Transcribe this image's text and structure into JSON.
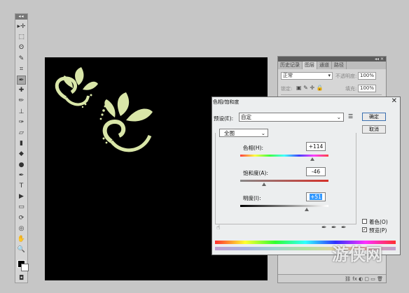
{
  "toolbar": {
    "tools": [
      "move-tool",
      "marquee-tool",
      "lasso-tool",
      "quick-select-tool",
      "crop-tool",
      "eyedropper-tool",
      "spot-heal-tool",
      "brush-tool",
      "stamp-tool",
      "history-brush-tool",
      "eraser-tool",
      "gradient-tool",
      "blur-tool",
      "dodge-tool",
      "pen-tool",
      "type-tool",
      "path-select-tool",
      "shape-tool",
      "3d-rotate-tool",
      "3d-orbit-tool",
      "hand-tool",
      "zoom-tool"
    ],
    "glyphs": [
      "▸✛",
      "⬚",
      "ʘ",
      "✎",
      "⌗",
      "✒",
      "✚",
      "✏",
      "⊥",
      "✑",
      "▱",
      "▮",
      "◆",
      "●",
      "✒",
      "T",
      "▶",
      "▭",
      "⟳",
      "◎",
      "✋",
      "🔍"
    ]
  },
  "layers_panel": {
    "tabs": [
      "历史记录",
      "图层",
      "通道",
      "路径"
    ],
    "active_tab": "图层",
    "blend_mode": "正常",
    "opacity_label": "不透明度:",
    "opacity_value": "100%",
    "lock_label": "锁定:",
    "fill_label": "填充:",
    "fill_value": "100%"
  },
  "dialog": {
    "title": "色相/饱和度",
    "preset_label": "预设(E):",
    "preset_value": "自定",
    "channel_value": "全图",
    "hue_label": "色相(H):",
    "hue_value": "+114",
    "hue_level": 0.82,
    "saturation_label": "饱和度(A):",
    "saturation_value": "-46",
    "saturation_level": 0.27,
    "lightness_label": "明度(I):",
    "lightness_value": "+51",
    "lightness_level": 0.75,
    "ok_label": "确定",
    "cancel_label": "取消",
    "colorize_label": "着色(O)",
    "preview_label": "预览(P)",
    "preview_checked": true,
    "colorize_checked": false
  },
  "artwork_color": "#d9e6a8",
  "watermark": "游侠网"
}
